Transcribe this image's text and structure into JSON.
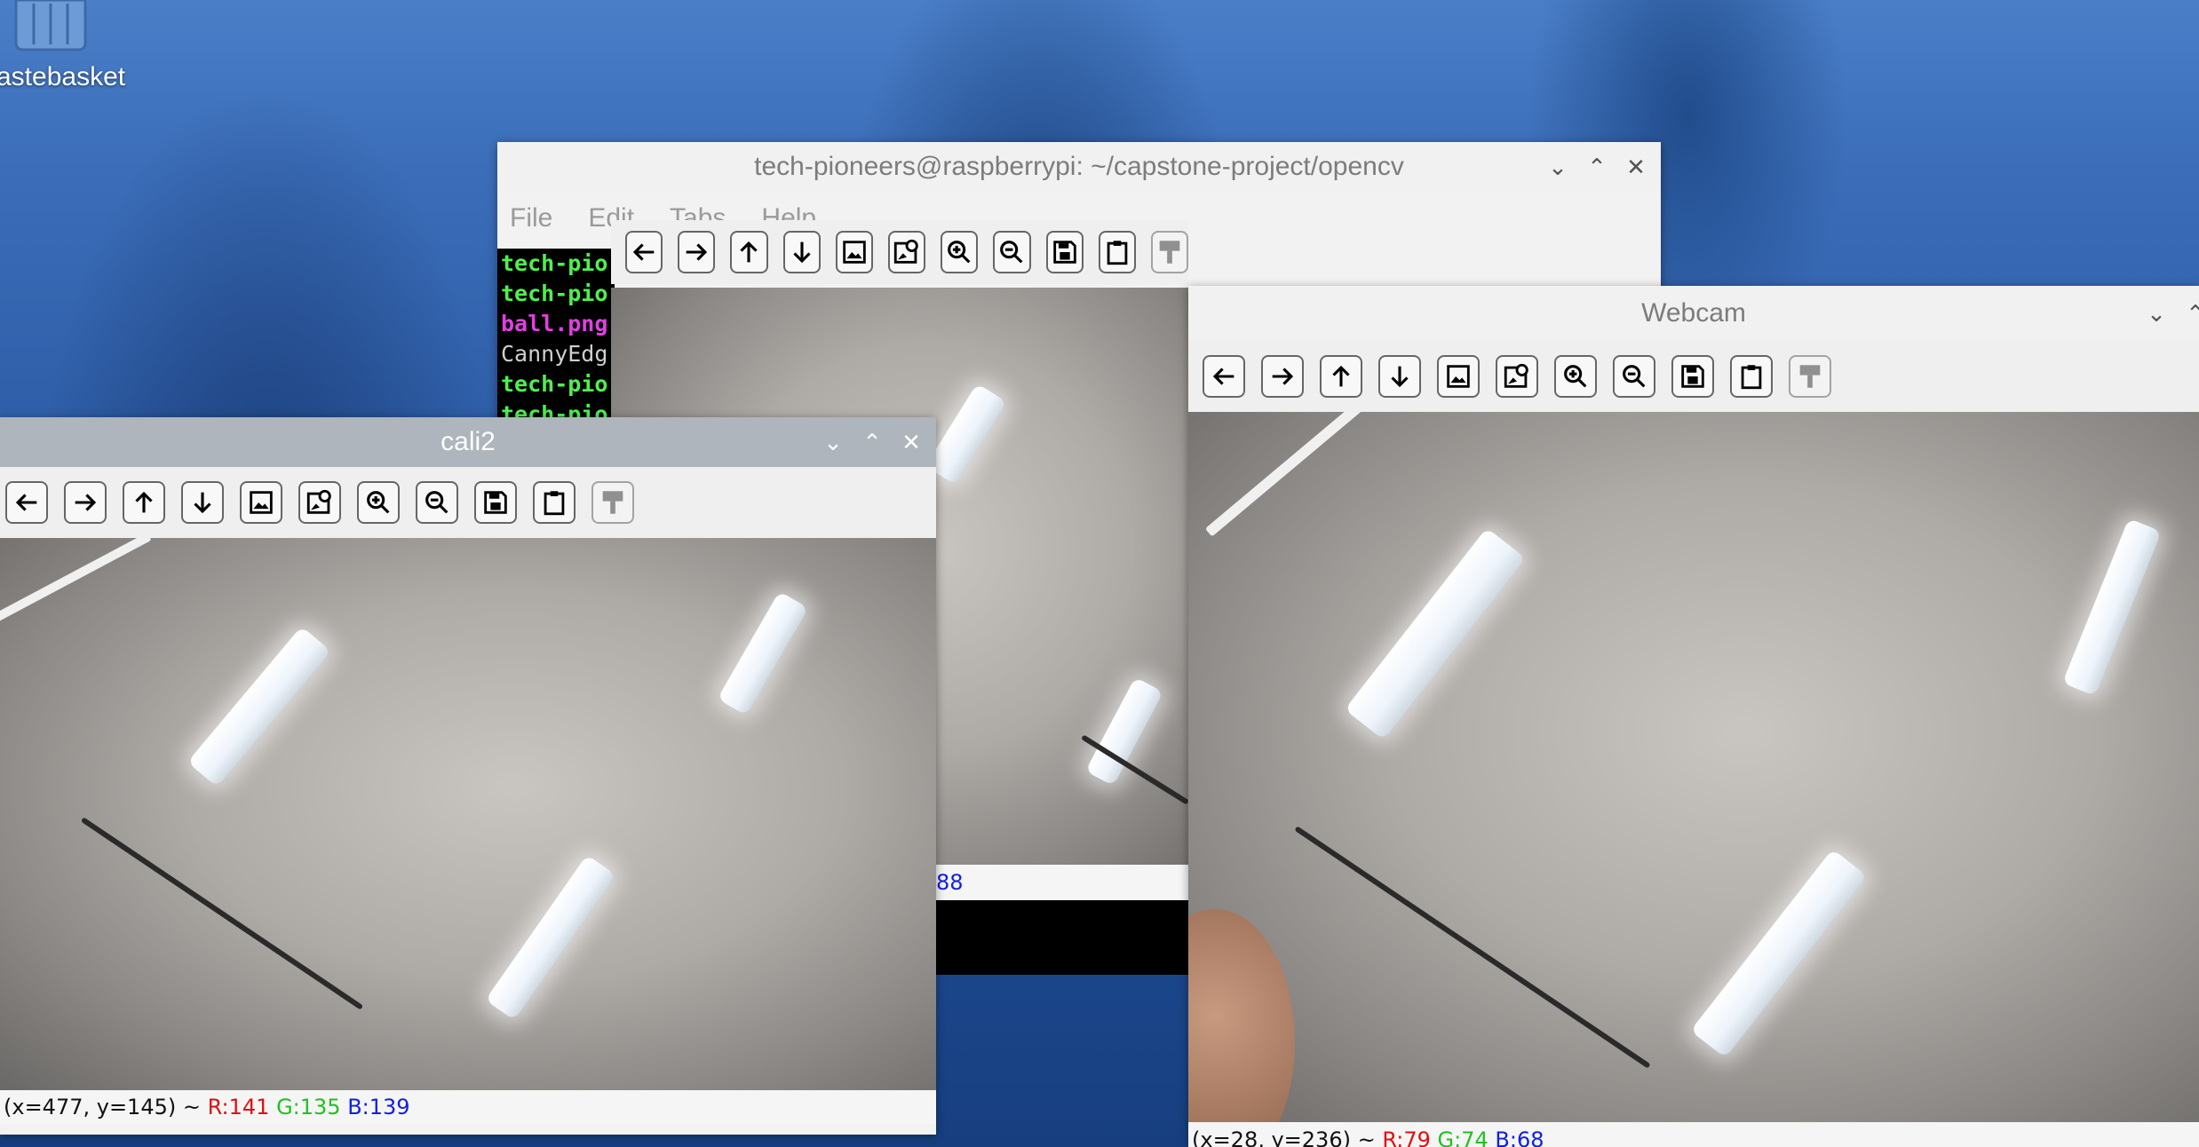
{
  "desktop": {
    "trash_label": "astebasket"
  },
  "terminal": {
    "title": "tech-pioneers@raspberrypi: ~/capstone-project/opencv",
    "menu": [
      "File",
      "Edit",
      "Tabs",
      "Help"
    ],
    "lines": [
      "tech-pio",
      "tech-pio",
      "ball.png",
      "CannyEdg",
      "tech-pio",
      "tech-pio"
    ]
  },
  "middle_window": {
    "status_partial": "88"
  },
  "cali2": {
    "title": "cali2",
    "status": {
      "coords": "(x=477, y=145) ~ ",
      "r": "R:141",
      "g": "G:135",
      "b": "B:139"
    }
  },
  "webcam": {
    "title": "Webcam",
    "status": {
      "coords": "(x=28, y=236) ~ ",
      "r": "R:79",
      "g": "G:74",
      "b": "B:68"
    }
  },
  "window_controls": {
    "minimize": "⌄",
    "maximize": "⌃",
    "close": "✕"
  },
  "toolbar_buttons": [
    "pan-left",
    "pan-right",
    "pan-up",
    "pan-down",
    "reset-zoom",
    "zoom-to-rect",
    "zoom-in",
    "zoom-out",
    "save",
    "copy-clipboard",
    "properties"
  ]
}
